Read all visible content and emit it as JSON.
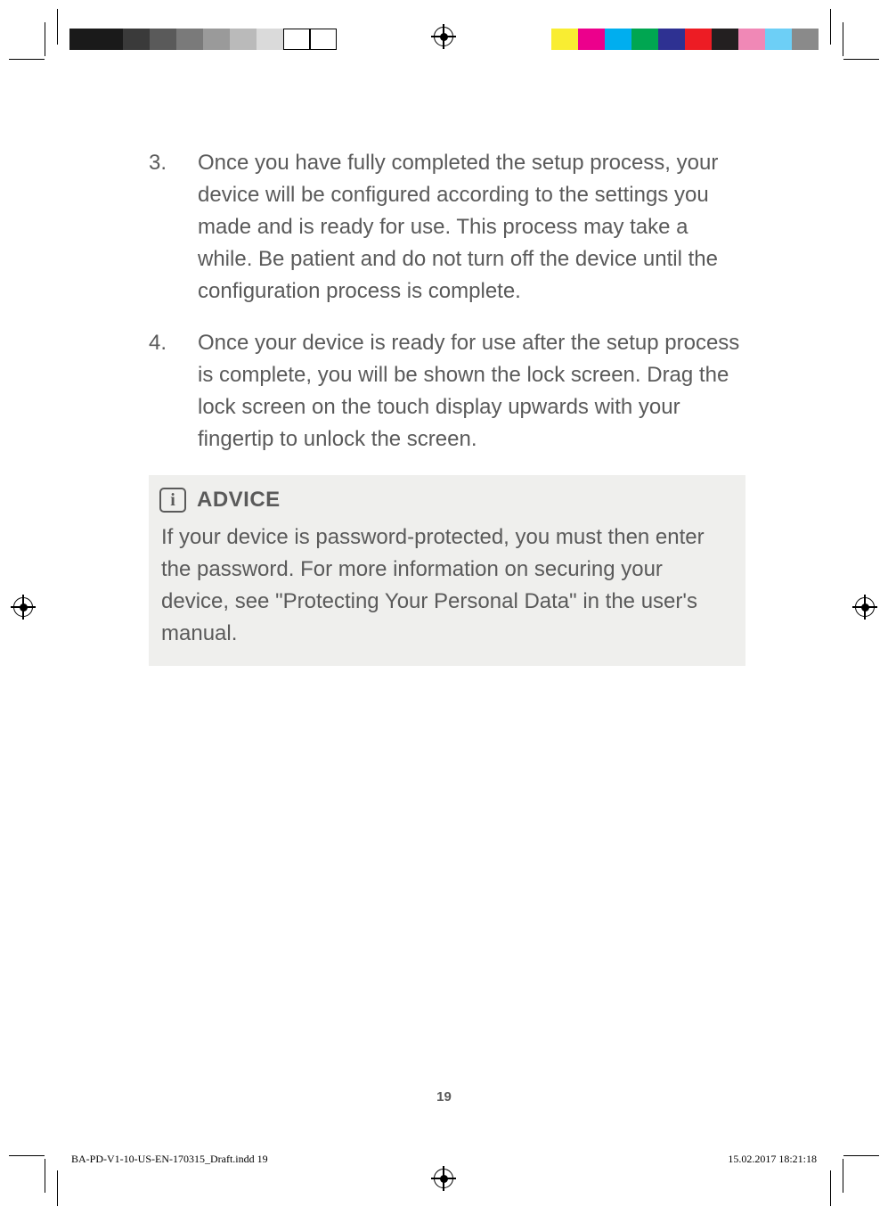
{
  "steps": [
    {
      "num": "3.",
      "text": "Once you have fully completed the setup process, your device will be configured according to the settings you made and is ready for use. This process may take a while. Be patient and do not turn off the device until the configuration process is complete."
    },
    {
      "num": "4.",
      "text": "Once your device is ready for use after the setup process is complete, you will be shown the lock screen. Drag the lock screen on the touch display upwards with your fingertip to unlock the screen."
    }
  ],
  "advice": {
    "title": "ADVICE",
    "icon_letter": "i",
    "body": "If your device is password-protected, you must then enter the password. For more information on securing your device, see \"Protecting Your Personal Data\" in the user's manual."
  },
  "page_number": "19",
  "footer": {
    "filename": "BA-PD-V1-10-US-EN-170315_Draft.indd   19",
    "timestamp": "15.02.2017   18:21:18"
  },
  "colorbars": {
    "left": [
      "#1a1a1a",
      "#1a1a1a",
      "#3a3a3a",
      "#5a5a5a",
      "#7a7a7a",
      "#9a9a9a",
      "#bababa",
      "#dadada",
      "#ffffff",
      "#ffffff"
    ],
    "right": [
      "#f9ed32",
      "#ec008c",
      "#00aeef",
      "#00a651",
      "#2e3192",
      "#ed1c24",
      "#231f20",
      "#f088b6",
      "#6dcff6",
      "#8a8a8a"
    ]
  }
}
